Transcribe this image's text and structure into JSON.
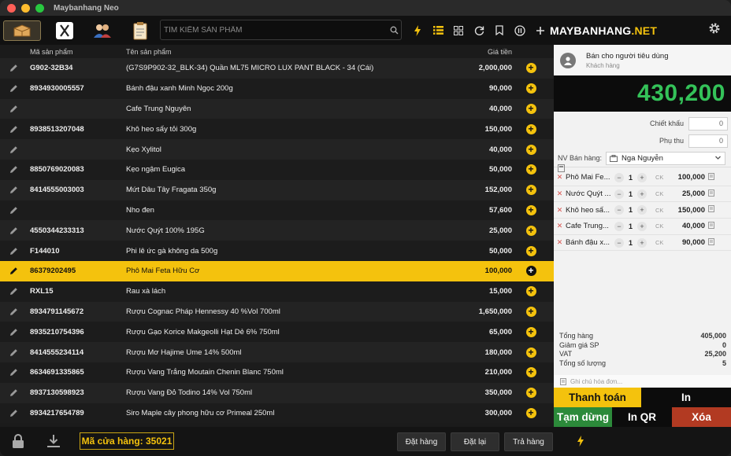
{
  "app": {
    "title": "Maybanhang Neo"
  },
  "brand": {
    "name": "MAYBANHANG",
    "dot": ".NET"
  },
  "search": {
    "placeholder": "TÌM KIẾM SẢN PHẨM"
  },
  "toolbar": {
    "icons": [
      "box-icon",
      "cutlery-icon",
      "users-icon",
      "clipboard-icon"
    ],
    "right_icons": [
      "bolt-icon",
      "list-icon",
      "grid-icon",
      "refresh-icon",
      "bookmark-icon",
      "pause-icon",
      "plus-icon"
    ]
  },
  "table": {
    "headers": {
      "code": "Mã sản phẩm",
      "name": "Tên sản phẩm",
      "price": "Giá tiền"
    },
    "rows": [
      {
        "code": "G902-32B34",
        "name": "(G7S9P902-32_BLK-34) Quần ML75 MICRO LUX PANT BLACK - 34 (Cái)",
        "price": "2,000,000",
        "selected": false
      },
      {
        "code": "8934930005557",
        "name": "Bánh đậu xanh Minh Ngọc 200g",
        "price": "90,000",
        "selected": false
      },
      {
        "code": "",
        "name": "Cafe Trung Nguyên",
        "price": "40,000",
        "selected": false
      },
      {
        "code": "8938513207048",
        "name": "Khô heo sấy tỏi 300g",
        "price": "150,000",
        "selected": false
      },
      {
        "code": "",
        "name": "Kẹo Xylitol",
        "price": "40,000",
        "selected": false
      },
      {
        "code": "8850769020083",
        "name": "Kẹo ngậm Eugica",
        "price": "50,000",
        "selected": false
      },
      {
        "code": "8414555003003",
        "name": "Mứt Dâu Tây Fragata 350g",
        "price": "152,000",
        "selected": false
      },
      {
        "code": "",
        "name": "Nho đen",
        "price": "57,600",
        "selected": false
      },
      {
        "code": "4550344233313",
        "name": "Nước Quýt 100% 195G",
        "price": "25,000",
        "selected": false
      },
      {
        "code": "F144010",
        "name": "Phi lê ức gà không da 500g",
        "price": "50,000",
        "selected": false
      },
      {
        "code": "86379202495",
        "name": "Phô Mai Feta Hữu Cơ",
        "price": "100,000",
        "selected": true
      },
      {
        "code": "RXL15",
        "name": "Rau xà lách",
        "price": "15,000",
        "selected": false
      },
      {
        "code": "8934791145672",
        "name": "Rượu Cognac Pháp Hennessy 40 %Vol 700ml",
        "price": "1,650,000",
        "selected": false
      },
      {
        "code": "8935210754396",
        "name": "Rượu Gạo Korice Makgeolli Hạt Dẻ 6% 750ml",
        "price": "65,000",
        "selected": false
      },
      {
        "code": "8414555234114",
        "name": "Rượu Mơ Hajime Ume 14% 500ml",
        "price": "180,000",
        "selected": false
      },
      {
        "code": "8634691335865",
        "name": "Rượu Vang Trắng Moutain Chenin Blanc 750ml",
        "price": "210,000",
        "selected": false
      },
      {
        "code": "8937130598923",
        "name": "Rượu Vang Đỏ Todino 14% Vol 750ml",
        "price": "350,000",
        "selected": false
      },
      {
        "code": "8934217654789",
        "name": "Siro Maple cây phong hữu cơ Primeal 250ml",
        "price": "300,000",
        "selected": false
      }
    ]
  },
  "order": {
    "customer_name": "Bán cho người tiêu dùng",
    "customer_sub": "Khách hàng",
    "total": "430,200",
    "discount_label": "Chiết khấu",
    "discount_value": "0",
    "surcharge_label": "Phụ thu",
    "surcharge_value": "0",
    "staff_label": "NV Bán hàng:",
    "staff_value": "Nga Nguyễn",
    "items": [
      {
        "name": "Phô Mai Fe...",
        "qty": "1",
        "ck": "CK",
        "price": "100,000"
      },
      {
        "name": "Nước Quýt ...",
        "qty": "1",
        "ck": "CK",
        "price": "25,000"
      },
      {
        "name": "Khô heo sấ...",
        "qty": "1",
        "ck": "CK",
        "price": "150,000"
      },
      {
        "name": "Cafe Trung...",
        "qty": "1",
        "ck": "CK",
        "price": "40,000"
      },
      {
        "name": "Bánh đậu x...",
        "qty": "1",
        "ck": "CK",
        "price": "90,000"
      }
    ],
    "summary": [
      {
        "label": "Tổng hàng",
        "value": "405,000"
      },
      {
        "label": "Giảm giá SP",
        "value": "0"
      },
      {
        "label": "VAT",
        "value": "25,200"
      },
      {
        "label": "Tổng số lượng",
        "value": "5"
      }
    ],
    "memo_placeholder": "Ghi chú hóa đơn..."
  },
  "actions": {
    "pay": "Thanh toán",
    "print": "In",
    "pause": "Tạm dừng",
    "qr": "In QR",
    "delete": "Xóa"
  },
  "bottom": {
    "store_code": "Mã cửa hàng: 35021",
    "order": "Đặt hàng",
    "reset": "Đặt lại",
    "return": "Trả hàng"
  },
  "colors": {
    "accent": "#f4c20d",
    "total_green": "#34c259",
    "pause_green": "#2c8a3a",
    "delete_red": "#b23a22"
  }
}
